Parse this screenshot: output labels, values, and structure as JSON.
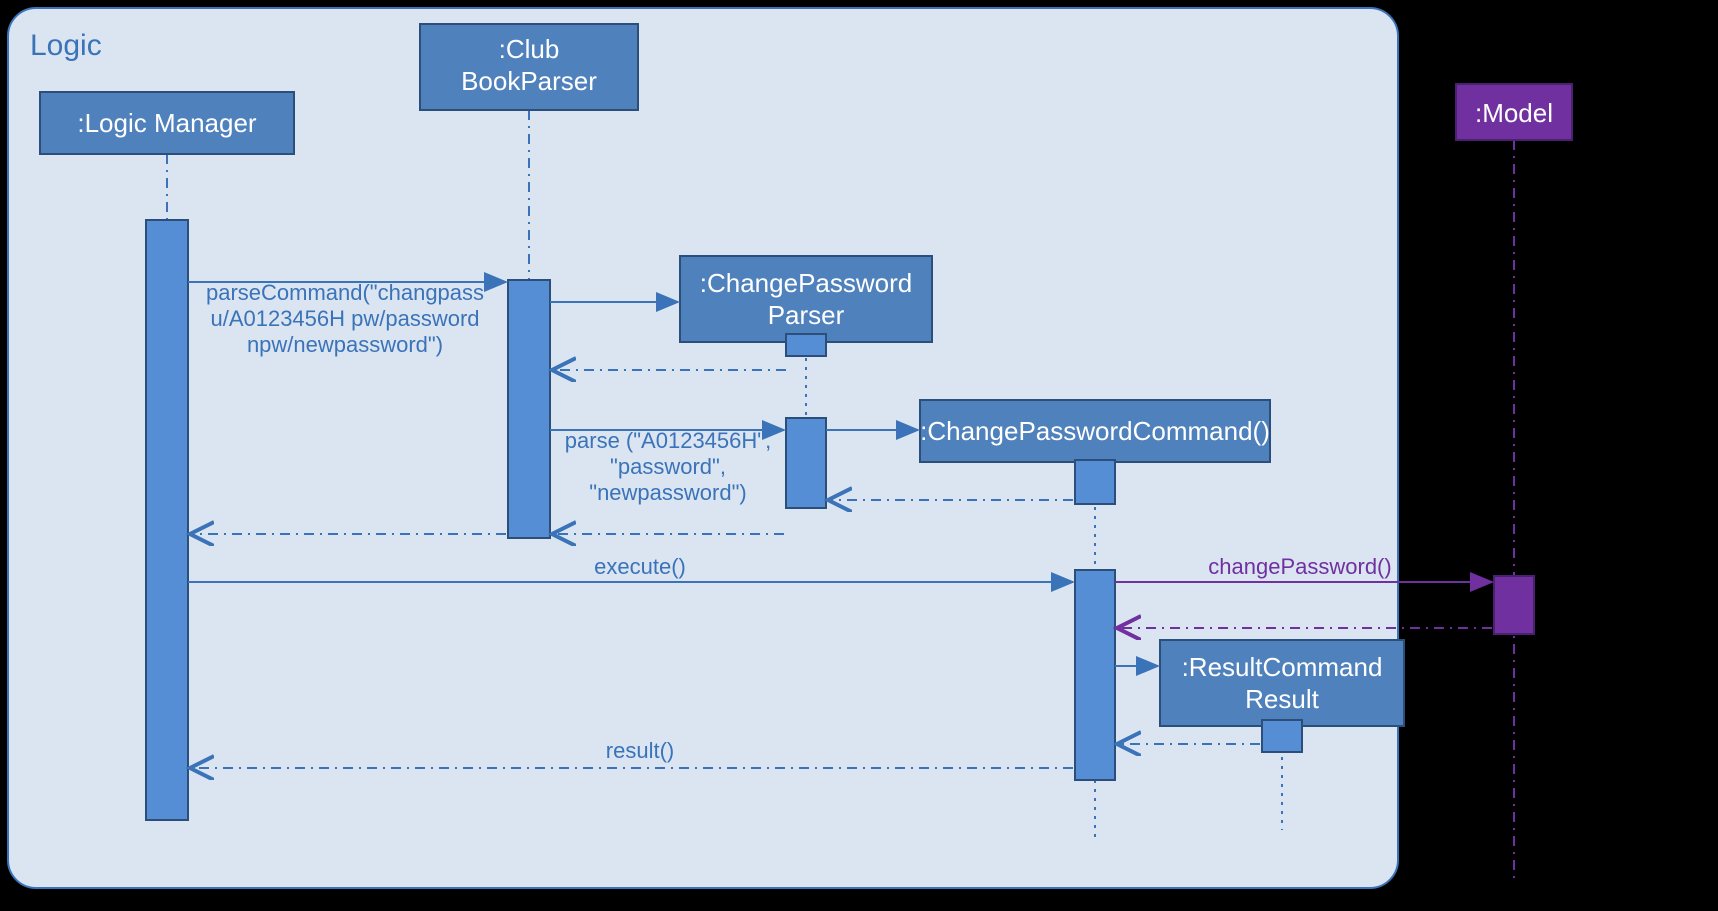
{
  "frame": {
    "label": "Logic"
  },
  "participants": {
    "logicManager": ":Logic Manager",
    "clubBookParser": ":Club BookParser",
    "changePasswordParser": ":ChangePassword Parser",
    "changePasswordCommand": ":ChangePasswordCommand()",
    "resultCommandResult": ":ResultCommand Result",
    "model": ":Model"
  },
  "messages": {
    "parseCommand": "parseCommand(\"changpass u/A0123456H pw/password npw/newpassword\")",
    "parse": "parse (\"A0123456H\", \"password\", \"newpassword\")",
    "execute": "execute()",
    "changePassword": "changePassword()",
    "result": "result()"
  }
}
